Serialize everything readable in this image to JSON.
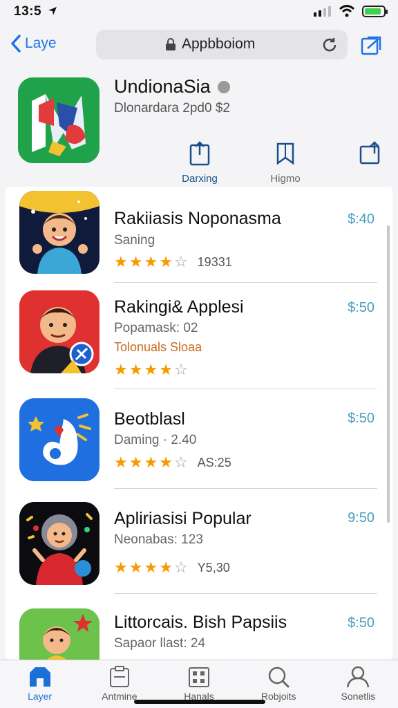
{
  "status": {
    "time": "13:5"
  },
  "nav": {
    "back_label": "Laye",
    "url": "Appbboiom"
  },
  "featured": {
    "title": "UndionaSia",
    "subtitle": "Dlonardara 2pd0 $2",
    "actions": [
      {
        "label": "Darxing",
        "icon": "share-icon"
      },
      {
        "label": "Higmo",
        "icon": "bookmark-icon"
      },
      {
        "label": "",
        "icon": "export-icon"
      }
    ]
  },
  "apps": [
    {
      "title": "Rakiiasis Noponasma",
      "subtitle": "Saning",
      "tag": "",
      "rating": 4,
      "count": "19331",
      "price": "$:40"
    },
    {
      "title": "Rakingi& Applesi",
      "subtitle": "Popamask: 02",
      "tag": "Tolonuals Sloaa",
      "rating": 4,
      "count": "",
      "price": "$:50"
    },
    {
      "title": "Beotblasl",
      "subtitle": "Daming · 2.40",
      "tag": "",
      "rating": 4,
      "count": "AS:25",
      "price": "$:50"
    },
    {
      "title": "Apliriasisi Popular",
      "subtitle": "Neonabas: 123",
      "tag": "",
      "rating": 4,
      "count": "Y5,30",
      "price": "9:50"
    },
    {
      "title": "Littorcais. Bish Papsiis",
      "subtitle": "Sapaor llast: 24",
      "tag": "",
      "rating": 0,
      "count": "",
      "price": "$:50"
    }
  ],
  "tabs": [
    {
      "label": "Layer",
      "icon": "store-icon",
      "active": true
    },
    {
      "label": "Antmine",
      "icon": "clipboard-icon",
      "active": false
    },
    {
      "label": "Hanals",
      "icon": "grid-icon",
      "active": false
    },
    {
      "label": "Robjoits",
      "icon": "search-icon",
      "active": false
    },
    {
      "label": "Sonetlis",
      "icon": "person-icon",
      "active": false
    }
  ],
  "colors": {
    "accent": "#1a73e8",
    "price": "#4a9dbf",
    "star": "#f49b00",
    "tag": "#c96a1c"
  }
}
